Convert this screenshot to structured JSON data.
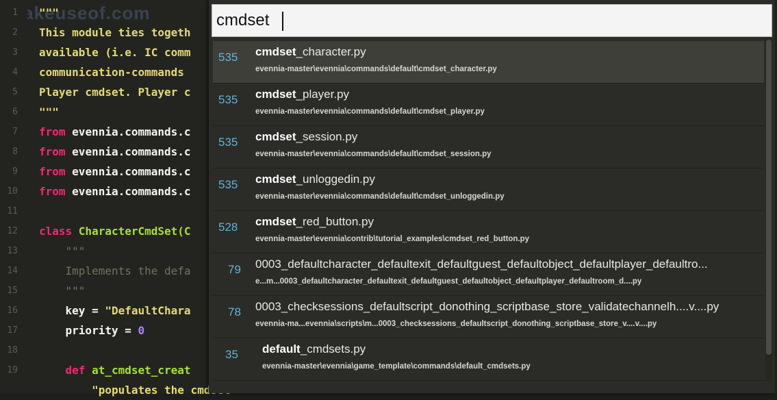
{
  "editor": {
    "watermark": "makeuseof.com",
    "lines": [
      {
        "n": "1",
        "parts": [
          {
            "t": "\"\"\"",
            "c": "str"
          }
        ]
      },
      {
        "n": "2",
        "parts": [
          {
            "t": "This module ties togeth",
            "c": "str"
          }
        ]
      },
      {
        "n": "3",
        "parts": [
          {
            "t": "available (i.e. IC comm",
            "c": "str"
          }
        ]
      },
      {
        "n": "4",
        "parts": [
          {
            "t": "communication-commands ",
            "c": "str"
          }
        ]
      },
      {
        "n": "5",
        "parts": [
          {
            "t": "Player cmdset. Player c",
            "c": "str"
          }
        ]
      },
      {
        "n": "6",
        "parts": [
          {
            "t": "\"\"\"",
            "c": "str"
          }
        ]
      },
      {
        "n": "7",
        "parts": [
          {
            "t": "from ",
            "c": "kw"
          },
          {
            "t": "evennia.commands.c",
            "c": "plain"
          }
        ]
      },
      {
        "n": "8",
        "parts": [
          {
            "t": "from ",
            "c": "kw"
          },
          {
            "t": "evennia.commands.c",
            "c": "plain"
          }
        ]
      },
      {
        "n": "9",
        "parts": [
          {
            "t": "from ",
            "c": "kw"
          },
          {
            "t": "evennia.commands.c",
            "c": "plain"
          }
        ]
      },
      {
        "n": "10",
        "parts": [
          {
            "t": "from ",
            "c": "kw"
          },
          {
            "t": "evennia.commands.c",
            "c": "plain"
          }
        ]
      },
      {
        "n": "11",
        "parts": []
      },
      {
        "n": "12",
        "parts": [
          {
            "t": "class ",
            "c": "kw"
          },
          {
            "t": "CharacterCmdSet(C",
            "c": "cls"
          }
        ]
      },
      {
        "n": "13",
        "parts": [
          {
            "t": "    \"\"\"",
            "c": "cmt"
          }
        ]
      },
      {
        "n": "14",
        "parts": [
          {
            "t": "    Implements the defa",
            "c": "cmt"
          }
        ]
      },
      {
        "n": "15",
        "parts": [
          {
            "t": "    \"\"\"",
            "c": "cmt"
          }
        ]
      },
      {
        "n": "16",
        "parts": [
          {
            "t": "    key = ",
            "c": "plain"
          },
          {
            "t": "\"DefaultChara",
            "c": "str"
          }
        ]
      },
      {
        "n": "17",
        "parts": [
          {
            "t": "    priority = ",
            "c": "plain"
          },
          {
            "t": "0",
            "c": "num"
          }
        ]
      },
      {
        "n": "18",
        "parts": []
      },
      {
        "n": "19",
        "parts": [
          {
            "t": "    def ",
            "c": "kw"
          },
          {
            "t": "at_cmdset_creat",
            "c": "cls"
          }
        ]
      },
      {
        "n": "",
        "parts": [
          {
            "t": "        \"populates the cmdset\"",
            "c": "str"
          }
        ]
      }
    ]
  },
  "palette": {
    "query": "cmdset",
    "results": [
      {
        "score": "535",
        "name_bold": "cmdset",
        "name_rest": "_character.py",
        "path": "evennia-master\\evennia\\commands\\default\\cmdset_character.py",
        "selected": true
      },
      {
        "score": "535",
        "name_bold": "cmdset",
        "name_rest": "_player.py",
        "path": "evennia-master\\evennia\\commands\\default\\cmdset_player.py",
        "selected": false
      },
      {
        "score": "535",
        "name_bold": "cmdset",
        "name_rest": "_session.py",
        "path": "evennia-master\\evennia\\commands\\default\\cmdset_session.py",
        "selected": false
      },
      {
        "score": "535",
        "name_bold": "cmdset",
        "name_rest": "_unloggedin.py",
        "path": "evennia-master\\evennia\\commands\\default\\cmdset_unloggedin.py",
        "selected": false
      },
      {
        "score": "528",
        "name_bold": "cmdset",
        "name_rest": "_red_button.py",
        "path": "evennia-master\\evennia\\contrib\\tutorial_examples\\cmdset_red_button.py",
        "selected": false
      },
      {
        "score": "79",
        "name_bold": "",
        "name_rest": "0003_defaultcharacter_defaultexit_defaultguest_defaultobject_defaultplayer_defaultro...",
        "path": "e...m...0003_defaultcharacter_defaultexit_defaultguest_defaultobject_defaultplayer_defaultroom_d....py",
        "selected": false
      },
      {
        "score": "78",
        "name_bold": "",
        "name_rest": "0003_checksessions_defaultscript_donothing_scriptbase_store_validatechannelh....v....py",
        "path": "evennia-ma...evennia\\scripts\\m...0003_checksessions_defaultscript_donothing_scriptbase_store_v....v....py",
        "selected": false
      },
      {
        "score": "35",
        "name_bold": "default",
        "name_rest": "_cmdsets.py",
        "path": "evennia-master\\evennia\\game_template\\commands\\default_cmdsets.py",
        "selected": false
      }
    ]
  },
  "colors": {
    "background": "#232420",
    "palette_bg": "#2b2c27",
    "selected_row": "#3e3f39",
    "score": "#5fb3d9",
    "keyword": "#f92672",
    "string": "#e6db74",
    "class": "#a6e22e"
  }
}
